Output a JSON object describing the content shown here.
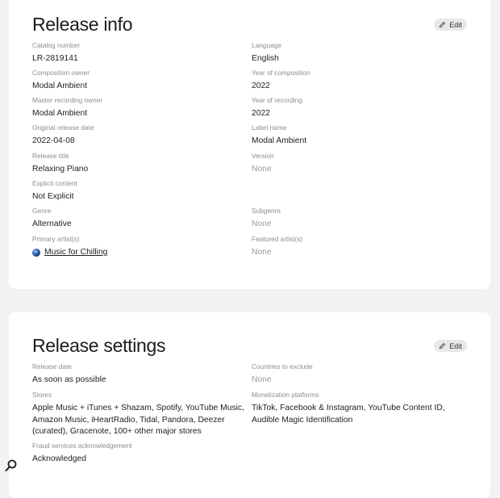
{
  "release_info": {
    "title": "Release info",
    "edit_label": "Edit",
    "left_fields": [
      {
        "label": "Catalog number",
        "value": "LR-2819141"
      },
      {
        "label": "Composition owner",
        "value": "Modal Ambient"
      },
      {
        "label": "Master recording owner",
        "value": "Modal Ambient"
      },
      {
        "label": "Original release date",
        "value": "2022-04-08"
      },
      {
        "label": "Release title",
        "value": "Relaxing Piano"
      },
      {
        "label": "Explicit content",
        "value": "Not Explicit"
      },
      {
        "label": "Genre",
        "value": "Alternative"
      },
      {
        "label": "Primary artist(s)",
        "value": "Music for Chilling"
      }
    ],
    "right_fields": [
      {
        "label": "Language",
        "value": "English"
      },
      {
        "label": "Year of composition",
        "value": "2022"
      },
      {
        "label": "Year of recording",
        "value": "2022"
      },
      {
        "label": "Label name",
        "value": "Modal Ambient"
      },
      {
        "label": "Version",
        "value": "None"
      },
      {
        "label": "Subgenre",
        "value": "None"
      },
      {
        "label": "Featured artist(s)",
        "value": "None"
      }
    ]
  },
  "release_settings": {
    "title": "Release settings",
    "edit_label": "Edit",
    "release_date": {
      "label": "Release date",
      "value": "As soon as possible"
    },
    "stores": {
      "label": "Stores",
      "value": "Apple Music + iTunes + Shazam, Spotify, YouTube Music, Amazon Music, iHeartRadio, Tidal, Pandora, Deezer (curated), Gracenote, 100+ other major stores"
    },
    "fraud": {
      "label": "Fraud services acknowledgement",
      "value": "Acknowledged"
    },
    "countries_exclude": {
      "label": "Countries to exclude",
      "value": "None"
    },
    "monetization": {
      "label": "Monetization platforms",
      "value": "TikTok, Facebook & Instagram, YouTube Content ID, Audible Magic Identification"
    }
  },
  "icons": {
    "edit": "pencil-icon",
    "artist": "globe-avatar-icon",
    "help": "magnifier-icon"
  },
  "colors": {
    "background": "#f2f2f2",
    "card": "#ffffff",
    "label": "#8d8d8d",
    "none_value": "#9a9a9a"
  }
}
